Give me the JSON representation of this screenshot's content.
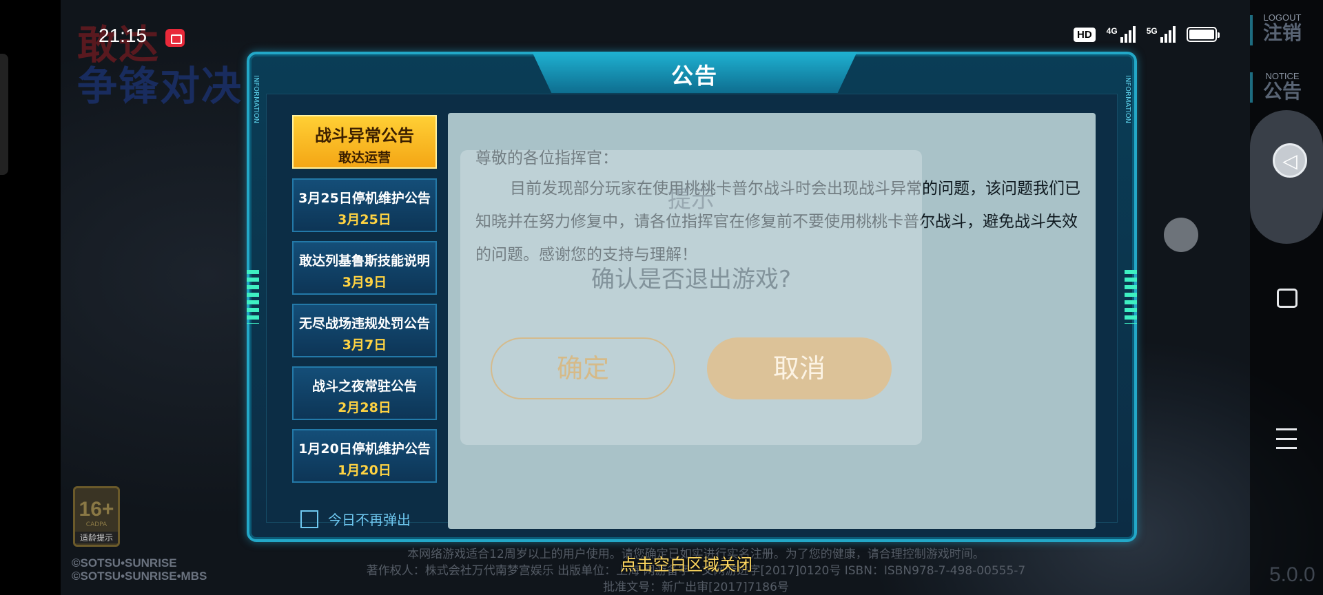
{
  "status_bar": {
    "time": "21:15",
    "hd_label": "HD",
    "net_4g": "4G",
    "net_5g": "5G"
  },
  "game_logo": {
    "line1": "敢达",
    "line2": "争锋对决"
  },
  "side_buttons": {
    "logout_en": "LOGOUT",
    "logout_cn": "注销",
    "notice_en": "NOTICE",
    "notice_cn": "公告"
  },
  "panel": {
    "title": "公告",
    "side_tag": "INFORMATION",
    "tabs": [
      {
        "title": "战斗异常公告",
        "date": "敢达运营",
        "active": true
      },
      {
        "title": "3月25日停机维护公告",
        "date": "3月25日",
        "active": false
      },
      {
        "title": "敢达列基鲁斯技能说明",
        "date": "3月9日",
        "active": false
      },
      {
        "title": "无尽战场违规处罚公告",
        "date": "3月7日",
        "active": false
      },
      {
        "title": "战斗之夜常驻公告",
        "date": "2月28日",
        "active": false
      },
      {
        "title": "1月20日停机维护公告",
        "date": "1月20日",
        "active": false
      }
    ],
    "checkbox_label": "今日不再弹出",
    "content": {
      "greeting": "尊敬的各位指挥官：",
      "body": "目前发现部分玩家在使用桃桃卡普尔战斗时会出现战斗异常的问题，该问题我们已知晓并在努力修复中，请各位指挥官在修复前不要使用桃桃卡普尔战斗，避免战斗失效的问题。感谢您的支持与理解！"
    }
  },
  "dialog": {
    "title": "提示",
    "message": "确认是否退出游戏?",
    "confirm_label": "确定",
    "cancel_label": "取消"
  },
  "age_badge": {
    "rating": "16+",
    "org": "CADPA",
    "tip": "适龄提示"
  },
  "copyright": {
    "line1": "©SOTSU•SUNRISE",
    "line2": "©SOTSU•SUNRISE•MBS"
  },
  "footer": {
    "line1": "本网络游戏适合12周岁以上的用户使用。请您确定已如实进行实名注册。为了您的健康，请合理控制游戏时间。",
    "line2": "著作权人：株式会社万代南梦宫娱乐  出版单位：上海           网游备字：文网游进字[2017]0120号 ISBN：ISBN978-7-498-00555-7",
    "line3": "批准文号：新广出审[2017]7186号"
  },
  "close_hint": "点击空白区域关闭",
  "version": "5.0.0"
}
